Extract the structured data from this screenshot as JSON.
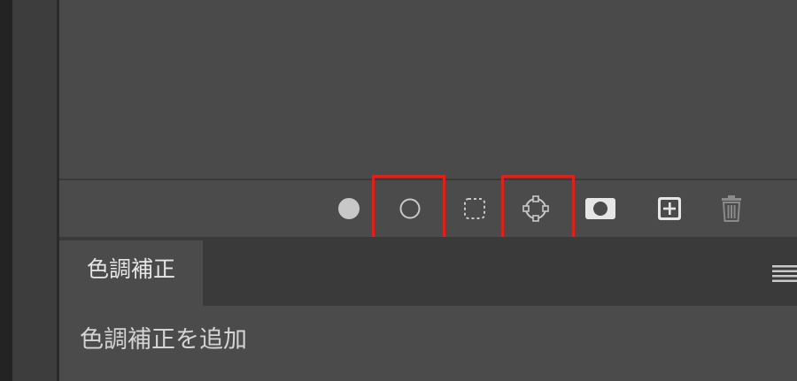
{
  "panel": {
    "tab_label": "色調補正",
    "heading": "色調補正を追加"
  },
  "toolbar": {
    "buttons": [
      {
        "name": "filled-circle-icon"
      },
      {
        "name": "hollow-circle-icon",
        "highlighted": true
      },
      {
        "name": "dotted-selection-icon"
      },
      {
        "name": "path-anchor-icon",
        "highlighted": true
      },
      {
        "name": "layer-mask-icon"
      },
      {
        "name": "new-layer-icon"
      },
      {
        "name": "trash-icon"
      }
    ]
  },
  "colors": {
    "highlight": "#e0201b",
    "panel_bg": "#4b4b4b",
    "icon": "#c8c8c8"
  }
}
